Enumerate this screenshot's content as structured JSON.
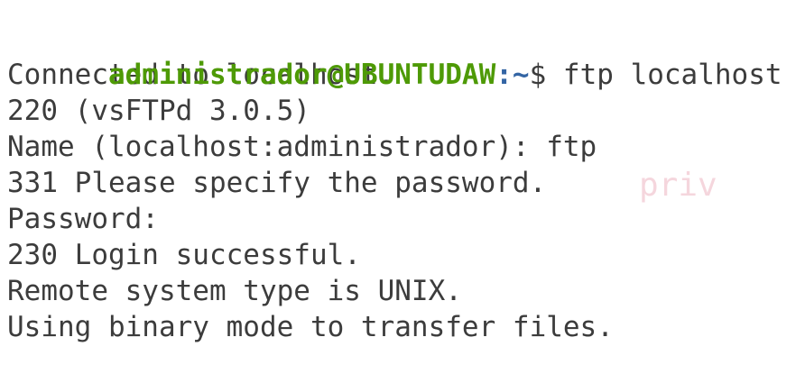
{
  "terminal": {
    "prompt": {
      "user_host": "administrador@UBUNTUDAW",
      "path": ":~",
      "sign": "$",
      "command": " ftp localhost"
    },
    "output_lines": [
      "Connected to localhost.",
      "220 (vsFTPd 3.0.5)",
      "Name (localhost:administrador): ftp",
      "331 Please specify the password.",
      "Password:",
      "230 Login successful.",
      "Remote system type is UNIX.",
      "Using binary mode to transfer files."
    ],
    "watermark": "priv",
    "colors": {
      "background": "#ffffff",
      "text": "#3c3c3c",
      "prompt_user": "#4e9a06",
      "prompt_path": "#3465a4",
      "watermark": "#f5d6dd"
    }
  }
}
